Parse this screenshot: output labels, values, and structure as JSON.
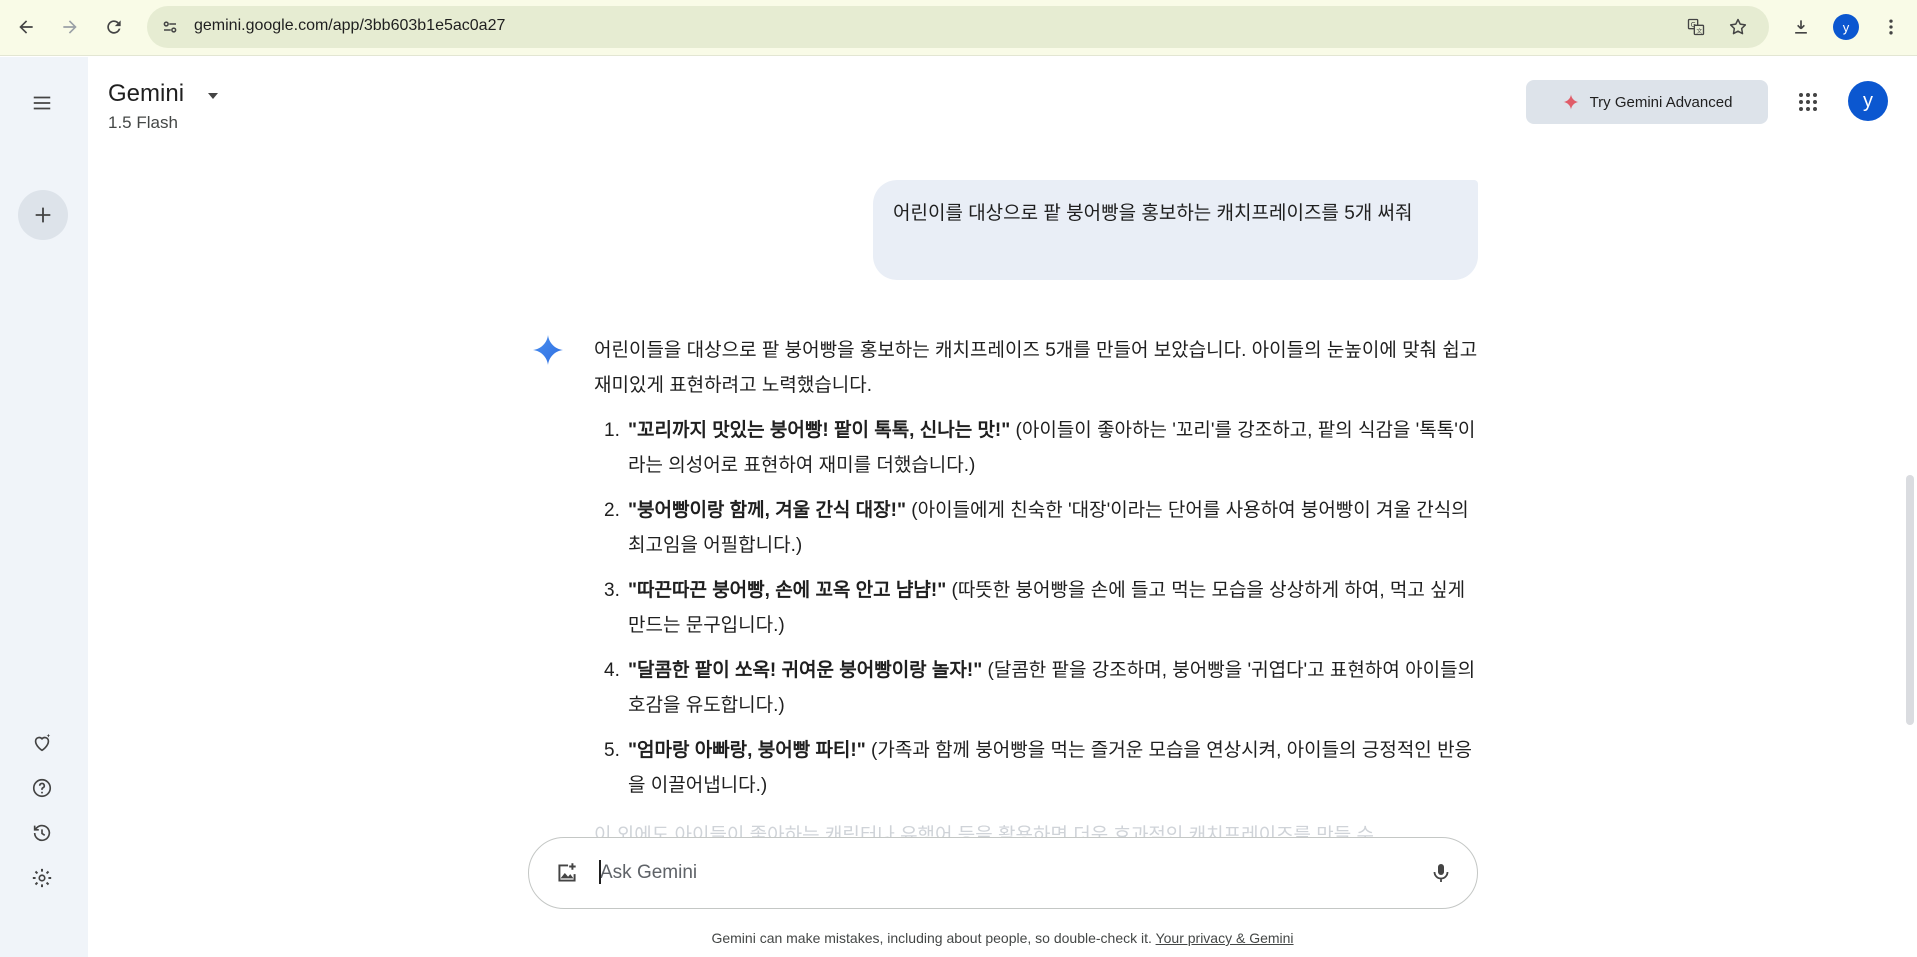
{
  "browser": {
    "url": "gemini.google.com/app/3bb603b1e5ac0a27",
    "profile_initial": "y"
  },
  "header": {
    "brand": "Gemini",
    "model": "1.5 Flash",
    "try_advanced_label": "Try Gemini Advanced",
    "account_initial": "y"
  },
  "conversation": {
    "user_message": "어린이를 대상으로 팥 붕어빵을 홍보하는 캐치프레이즈를 5개 써줘",
    "response_intro": "어린이들을 대상으로 팥 붕어빵을 홍보하는 캐치프레이즈 5개를 만들어 보았습니다. 아이들의 눈높이에 맞춰 쉽고 재미있게 표현하려고 노력했습니다.",
    "items": [
      {
        "num": "1.",
        "quote": "\"꼬리까지 맛있는 붕어빵! 팥이 톡톡, 신나는 맛!\"",
        "note": " (아이들이 좋아하는 '꼬리'를 강조하고, 팥의 식감을 '톡톡'이라는 의성어로 표현하여 재미를 더했습니다.)"
      },
      {
        "num": "2.",
        "quote": "\"붕어빵이랑 함께, 겨울 간식 대장!\"",
        "note": " (아이들에게 친숙한 '대장'이라는 단어를 사용하여 붕어빵이 겨울 간식의 최고임을 어필합니다.)"
      },
      {
        "num": "3.",
        "quote": "\"따끈따끈 붕어빵, 손에 꼬옥 안고 냠냠!\"",
        "note": " (따뜻한 붕어빵을 손에 들고 먹는 모습을 상상하게 하여, 먹고 싶게 만드는 문구입니다.)"
      },
      {
        "num": "4.",
        "quote": "\"달콤한 팥이 쏘옥! 귀여운 붕어빵이랑 놀자!\"",
        "note": " (달콤한 팥을 강조하며, 붕어빵을 '귀엽다'고 표현하여 아이들의 호감을 유도합니다.)"
      },
      {
        "num": "5.",
        "quote": "\"엄마랑 아빠랑, 붕어빵 파티!\"",
        "note": " (가족과 함께 붕어빵을 먹는 즐거운 모습을 연상시켜, 아이들의 긍정적인 반응을 이끌어냅니다.)"
      }
    ],
    "faded_line": "이 외에도 아이들이 좋아하는 캐릭터나 유행어 등을 활용하면 더욱 효과적인 캐치프레이즈를 만들 수"
  },
  "input": {
    "placeholder": "Ask Gemini"
  },
  "footer": {
    "disclaimer": "Gemini can make mistakes, including about people, so double-check it.",
    "privacy_link": "Your privacy & Gemini"
  },
  "icons": {
    "back": "back-arrow-icon",
    "forward": "forward-arrow-icon",
    "reload": "reload-icon",
    "site_info": "tune-icon",
    "translate": "translate-icon",
    "bookmark": "star-icon",
    "download": "download-icon",
    "menu": "more-vert-icon",
    "hamburger": "hamburger-menu-icon",
    "new_chat": "plus-icon",
    "gems": "gem-heart-icon",
    "help": "help-icon",
    "activity": "history-icon",
    "settings": "gear-icon",
    "apps": "apps-grid-icon",
    "add_image": "add-image-icon",
    "mic": "mic-icon"
  },
  "colors": {
    "accent": "#0b57d0",
    "sidebar_bg": "#f0f4f9",
    "bubble_bg": "#e9eef6",
    "browser_bg": "#f9fbe7"
  }
}
